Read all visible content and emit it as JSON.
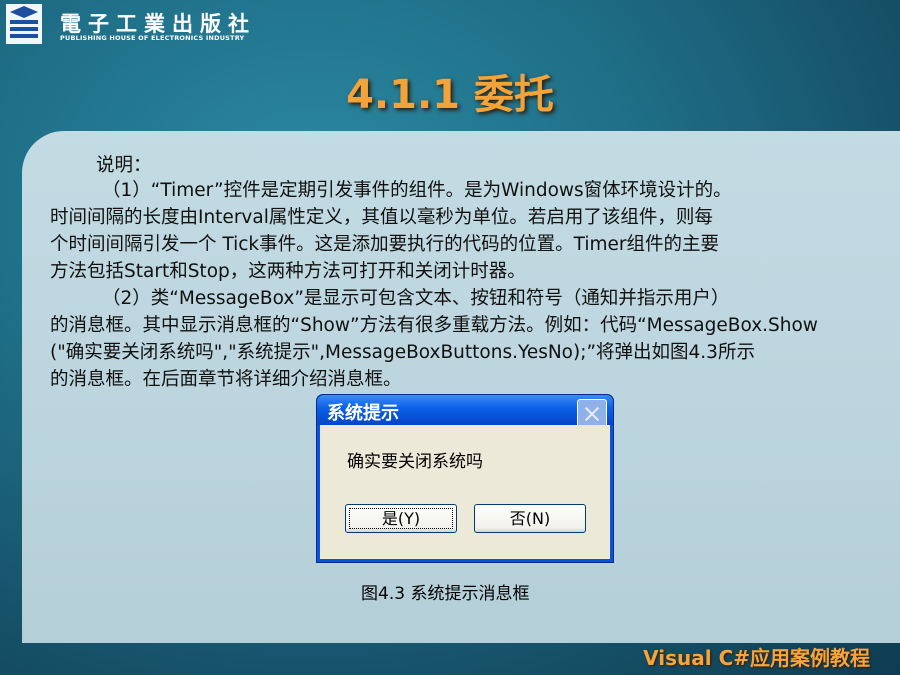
{
  "header": {
    "publisher": "電子工業出版社",
    "publisher_en": "PUBLISHING HOUSE OF ELECTRONICS INDUSTRY"
  },
  "slide": {
    "title": "4.1.1 委托"
  },
  "content": {
    "lines": [
      "说明：",
      "（1）“Timer”控件是定期引发事件的组件。是为Windows窗体环境设计的。",
      "时间间隔的长度由Interval属性定义，其值以毫秒为单位。若启用了该组件，则每",
      "个时间间隔引发一个 Tick事件。这是添加要执行的代码的位置。Timer组件的主要",
      "方法包括Start和Stop，这两种方法可打开和关闭计时器。",
      "（2）类“MessageBox”是显示可包含文本、按钮和符号（通知并指示用户）",
      "的消息框。其中显示消息框的“Show”方法有很多重载方法。例如：代码“MessageBox.Show",
      "(\"确实要关闭系统吗\",\"系统提示\",MessageBoxButtons.YesNo);”将弹出如图4.3所示",
      "的消息框。在后面章节将详细介绍消息框。"
    ]
  },
  "dialog": {
    "title": "系统提示",
    "message": "确实要关闭系统吗",
    "yes_label": "是(Y)",
    "no_label": "否(N)",
    "close_icon": "close-icon"
  },
  "figure": {
    "caption": "图4.3  系统提示消息框"
  },
  "footer": {
    "text": "Visual  C#应用案例教程"
  },
  "colors": {
    "title": "#f2a33a",
    "footer": "#f6a53a",
    "dialog_title_bar": "#0a5fe6",
    "dialog_body": "#ece9d8"
  }
}
